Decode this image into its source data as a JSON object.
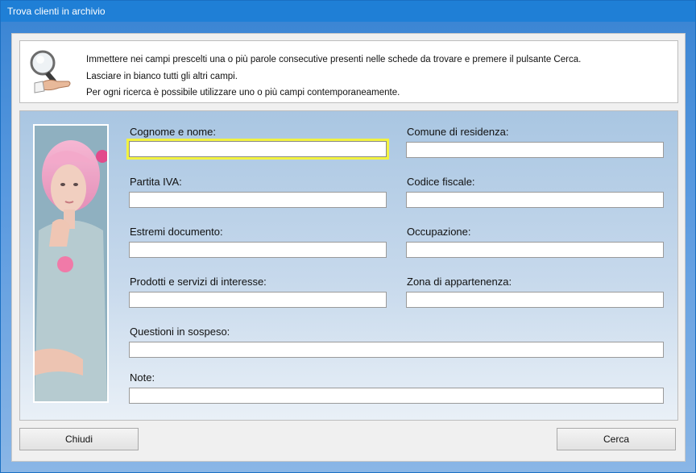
{
  "window": {
    "title": "Trova clienti in archivio"
  },
  "info": {
    "line1": "Immettere nei campi prescelti una o più parole consecutive presenti nelle schede da trovare e premere il pulsante Cerca.",
    "line2": "Lasciare in bianco tutti gli altri campi.",
    "line3": "Per ogni ricerca è possibile utilizzare uno o più campi contemporaneamente."
  },
  "fields": {
    "cognome_nome": {
      "label": "Cognome e nome:",
      "value": ""
    },
    "comune_residenza": {
      "label": "Comune di residenza:",
      "value": ""
    },
    "partita_iva": {
      "label": "Partita IVA:",
      "value": ""
    },
    "codice_fiscale": {
      "label": "Codice fiscale:",
      "value": ""
    },
    "estremi_documento": {
      "label": "Estremi documento:",
      "value": ""
    },
    "occupazione": {
      "label": "Occupazione:",
      "value": ""
    },
    "prodotti_servizi": {
      "label": "Prodotti e servizi di interesse:",
      "value": ""
    },
    "zona_appartenenza": {
      "label": "Zona di appartenenza:",
      "value": ""
    },
    "questioni_sospeso": {
      "label": "Questioni in sospeso:",
      "value": ""
    },
    "note": {
      "label": "Note:",
      "value": ""
    }
  },
  "buttons": {
    "close_label": "Chiudi",
    "search_label": "Cerca"
  },
  "icons": {
    "info_icon": "magnifier-in-hand-icon"
  },
  "colors": {
    "focus_border": "#f2f241",
    "titlebar": "#1f7fd6"
  }
}
